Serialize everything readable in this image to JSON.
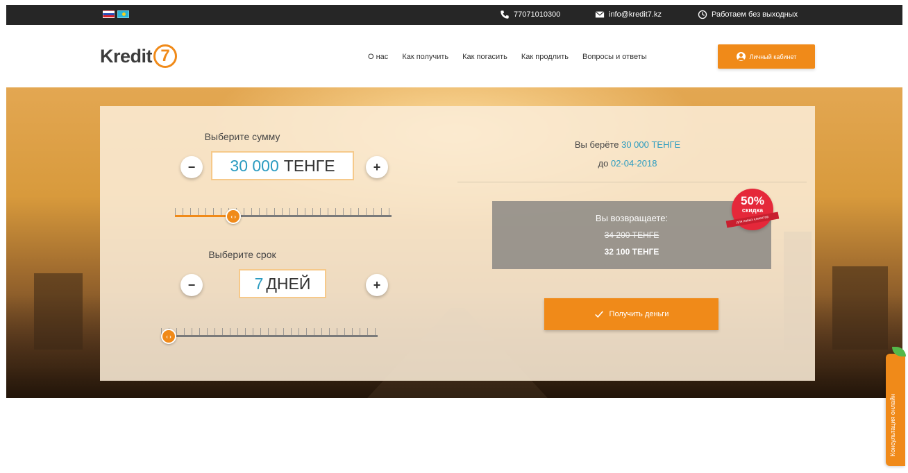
{
  "topbar": {
    "languages": [
      "ru",
      "kz"
    ],
    "phone": "77071010300",
    "email": "info@kredit7.kz",
    "hours": "Работаем без выходных"
  },
  "header": {
    "logo_text": "Kredit",
    "logo_number": "7",
    "nav": [
      "О нас",
      "Как получить",
      "Как погасить",
      "Как продлить",
      "Вопросы и ответы"
    ],
    "cabinet_label": "Личный кабинет"
  },
  "calculator": {
    "amount_label": "Выберите сумму",
    "amount_value": "30 000",
    "amount_unit": "ТЕНГЕ",
    "term_label": "Выберите срок",
    "term_value": "7",
    "term_unit": "ДНЕЙ",
    "minus": "−",
    "plus": "+",
    "slider_thumb": "‹ ›",
    "amount_slider_fraction": 0.27,
    "term_slider_fraction": 0.0
  },
  "summary": {
    "take_prefix": "Вы берёте",
    "take_amount": "30 000 ТЕНГЕ",
    "until_prefix": "до",
    "date": "02-04-2018",
    "return_title": "Вы возвращаете:",
    "return_old": "34 200 ТЕНГЕ",
    "return_new": "32 100 ТЕНГЕ",
    "badge_percent": "50%",
    "badge_word": "скидка",
    "badge_ribbon": "для новых клиентов",
    "get_money": "Получить деньги"
  },
  "chat": {
    "label": "Консультация онлайн"
  },
  "colors": {
    "accent": "#f08a19",
    "highlight": "#2a9bc0",
    "badge": "#e5283a",
    "topbar": "#262626"
  }
}
